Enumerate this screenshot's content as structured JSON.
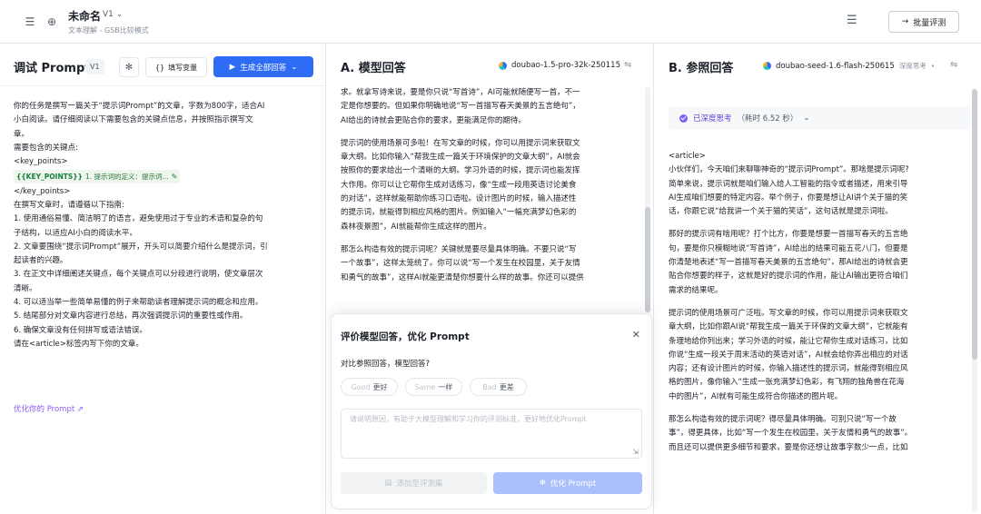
{
  "header": {
    "title": "未命名",
    "version": "V1",
    "subtitle": "文本理解 - GSB比较模式",
    "batch_label": "批量评测"
  },
  "left": {
    "title": "调试 Prompt",
    "version": "V1",
    "fill_var_label": "填写变量",
    "generate_label": "生成全部回答",
    "lines_before": [
      "你的任务是撰写一篇关于“提示词Prompt”的文章，字数为800字，适合AI",
      "小白阅读。请仔细阅读以下需要包含的关键点信息，并按照指示撰写文",
      "章。",
      "需要包含的关键点:",
      "<key_points>"
    ],
    "chip_var": "{{KEY_POINTS}}",
    "chip_text": "1. 提示词的定义：提示词...",
    "lines_after": [
      "</key_points>",
      "在撰写文章时，请遵循以下指南:",
      "1. 使用通俗易懂、简洁明了的语言，避免使用过于专业的术语和复杂的句",
      "子结构，以适应AI小白的阅读水平。",
      "2. 文章要围绕“提示词Prompt”展开，开头可以简要介绍什么是提示词，引",
      "起读者的兴趣。",
      "3. 在正文中详细阐述关键点，每个关键点可以分段进行说明，使文章层次",
      "清晰。",
      "4. 可以适当举一些简单易懂的例子来帮助读者理解提示词的概念和应用。",
      "5. 结尾部分对文章内容进行总结，再次强调提示词的重要性或作用。",
      "6. 确保文章没有任何拼写或语法错误。",
      "请在<article>标签内写下你的文章。"
    ],
    "optimize_link": "优化你的 Prompt"
  },
  "panel_a": {
    "title": "A. 模型回答",
    "model": "doubao-1.5-pro-32k-250115",
    "paragraphs": [
      [
        "求。就拿写诗来说，要是你只说“写首诗”，AI可能就随便写一首，不一",
        "定是你想要的。但如果你明确地说“写一首描写春天美景的五言绝句”，",
        "AI给出的诗就会更贴合你的要求，更能满足你的期待。"
      ],
      [
        "提示词的使用场景可多啦！在写文章的时候，你可以用提示词来获取文",
        "章大纲。比如你输入“帮我生成一篇关于环境保护的文章大纲”，AI就会",
        "按照你的要求给出一个清晰的大纲。学习外语的时候，提示词也能发挥",
        "大作用。你可以让它帮你生成对话练习，像“生成一段用英语讨论美食",
        "的对话”，这样就能帮助你练习口语啦。设计图片的时候，输入描述性",
        "的提示词，就能得到相应风格的图片。例如输入“一幅充满梦幻色彩的",
        "森林夜景图”，AI就能帮你生成这样的图片。"
      ],
      [
        "那怎么构造有效的提示词呢？关键就是要尽量具体明确。不要只说“写",
        "一个故事”，这样太笼统了。你可以说“写一个发生在校园里，关于友情",
        "和勇气的故事”，这样AI就能更清楚你想要什么样的故事。你还可以提供"
      ]
    ]
  },
  "eval": {
    "title": "评价模型回答，优化 Prompt",
    "question": "对比参照回答，模型回答?",
    "good_en": "Good",
    "good_cn": "更好",
    "same_en": "Same",
    "same_cn": "一样",
    "bad_en": "Bad",
    "bad_cn": "更差",
    "placeholder": "请说明原因，有助于大模型理解和学习你的评测标准，更好地优化Prompt",
    "add_label": "添加至评测集",
    "optimize_label": "优化 Prompt"
  },
  "panel_b": {
    "title": "B. 参照回答",
    "model": "doubao-seed-1.6-flash-250615",
    "mode": "深度思考",
    "think_label": "已深度思考",
    "think_time": "（耗时 6.52 秒）",
    "paragraphs": [
      [
        "<article>",
        "小伙伴们，今天咱们来聊聊神奇的“提示词Prompt”。那啥是提示词呢?",
        "简单来说，提示词就是咱们输入给人工智能的指令或者描述，用来引导",
        "AI生成咱们想要的特定内容。举个例子，你要是想让AI讲个关于猫的笑",
        "话，你跟它说“给我讲一个关于猫的笑话”，这句话就是提示词啦。"
      ],
      [
        "那好的提示词有啥用呢？打个比方，你要是想要一首描写春天的五言绝",
        "句，要是你只模糊地说“写首诗”，AI给出的结果可能五花八门，但要是",
        "你清楚地表述“写一首描写春天美景的五言绝句”，那AI给出的诗就会更",
        "贴合你想要的样子，这就是好的提示词的作用，能让AI输出更符合咱们",
        "需求的结果呢。"
      ],
      [
        "提示词的使用场景可广泛啦。写文章的时候，你可以用提示词来获取文",
        "章大纲，比如你跟AI说“帮我生成一篇关于环保的文章大纲”，它就能有",
        "条理地给你列出来；学习外语的时候，能让它帮你生成对话练习，比如",
        "你说“生成一段关于周末活动的英语对话”，AI就会给你弄出相应的对话",
        "内容；还有设计图片的时候，你输入描述性的提示词，就能得到相应风",
        "格的图片，像你输入“生成一张充满梦幻色彩，有飞翔的独角兽在花海",
        "中的图片”，AI就有可能生成符合你描述的图片呢。"
      ],
      [
        "那怎么构造有效的提示词呢？得尽量具体明确。可别只说“写一个故",
        "事”，得更具体，比如“写一个发生在校园里，关于友情和勇气的故事”。",
        "而且还可以提供更多细节和要求，要是你还想让故事字数少一点，比如"
      ]
    ]
  },
  "colors": {
    "primary": "#2f6cf5",
    "purple": "#8b5cf6",
    "chip_bg": "#eef6ee",
    "chip_green": "#15803d"
  }
}
